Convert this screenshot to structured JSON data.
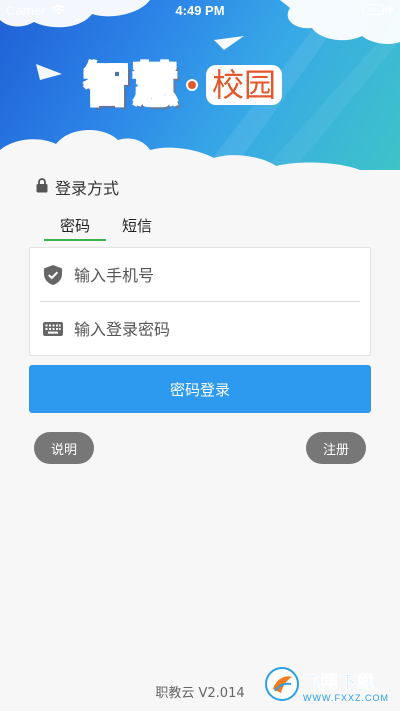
{
  "status_bar": {
    "carrier": "Carrier",
    "time": "4:49 PM"
  },
  "banner": {
    "logo_main": "智慧",
    "logo_sub": "校园"
  },
  "login": {
    "section_title": "登录方式",
    "tabs": [
      {
        "label": "密码",
        "active": true
      },
      {
        "label": "短信",
        "active": false
      }
    ],
    "phone_placeholder": "输入手机号",
    "password_placeholder": "输入登录密码",
    "submit_label": "密码登录",
    "help_label": "说明",
    "register_label": "注册"
  },
  "footer": {
    "version": "职教云 V2.014"
  },
  "watermark": {
    "title": "飞翔下载",
    "url": "WWW.FXXZ.COM"
  },
  "colors": {
    "primary_button": "#2d9af0",
    "active_tab_underline": "#3eb24a",
    "pill_button": "#777777",
    "logo_orange": "#f07a1c",
    "banner_start": "#1f5fd6",
    "banner_end": "#3fc4c8"
  },
  "icons": {
    "lock": "lock-icon",
    "shield": "shield-check-icon",
    "keyboard": "keyboard-icon",
    "wifi": "wifi-icon",
    "battery": "battery-icon"
  }
}
